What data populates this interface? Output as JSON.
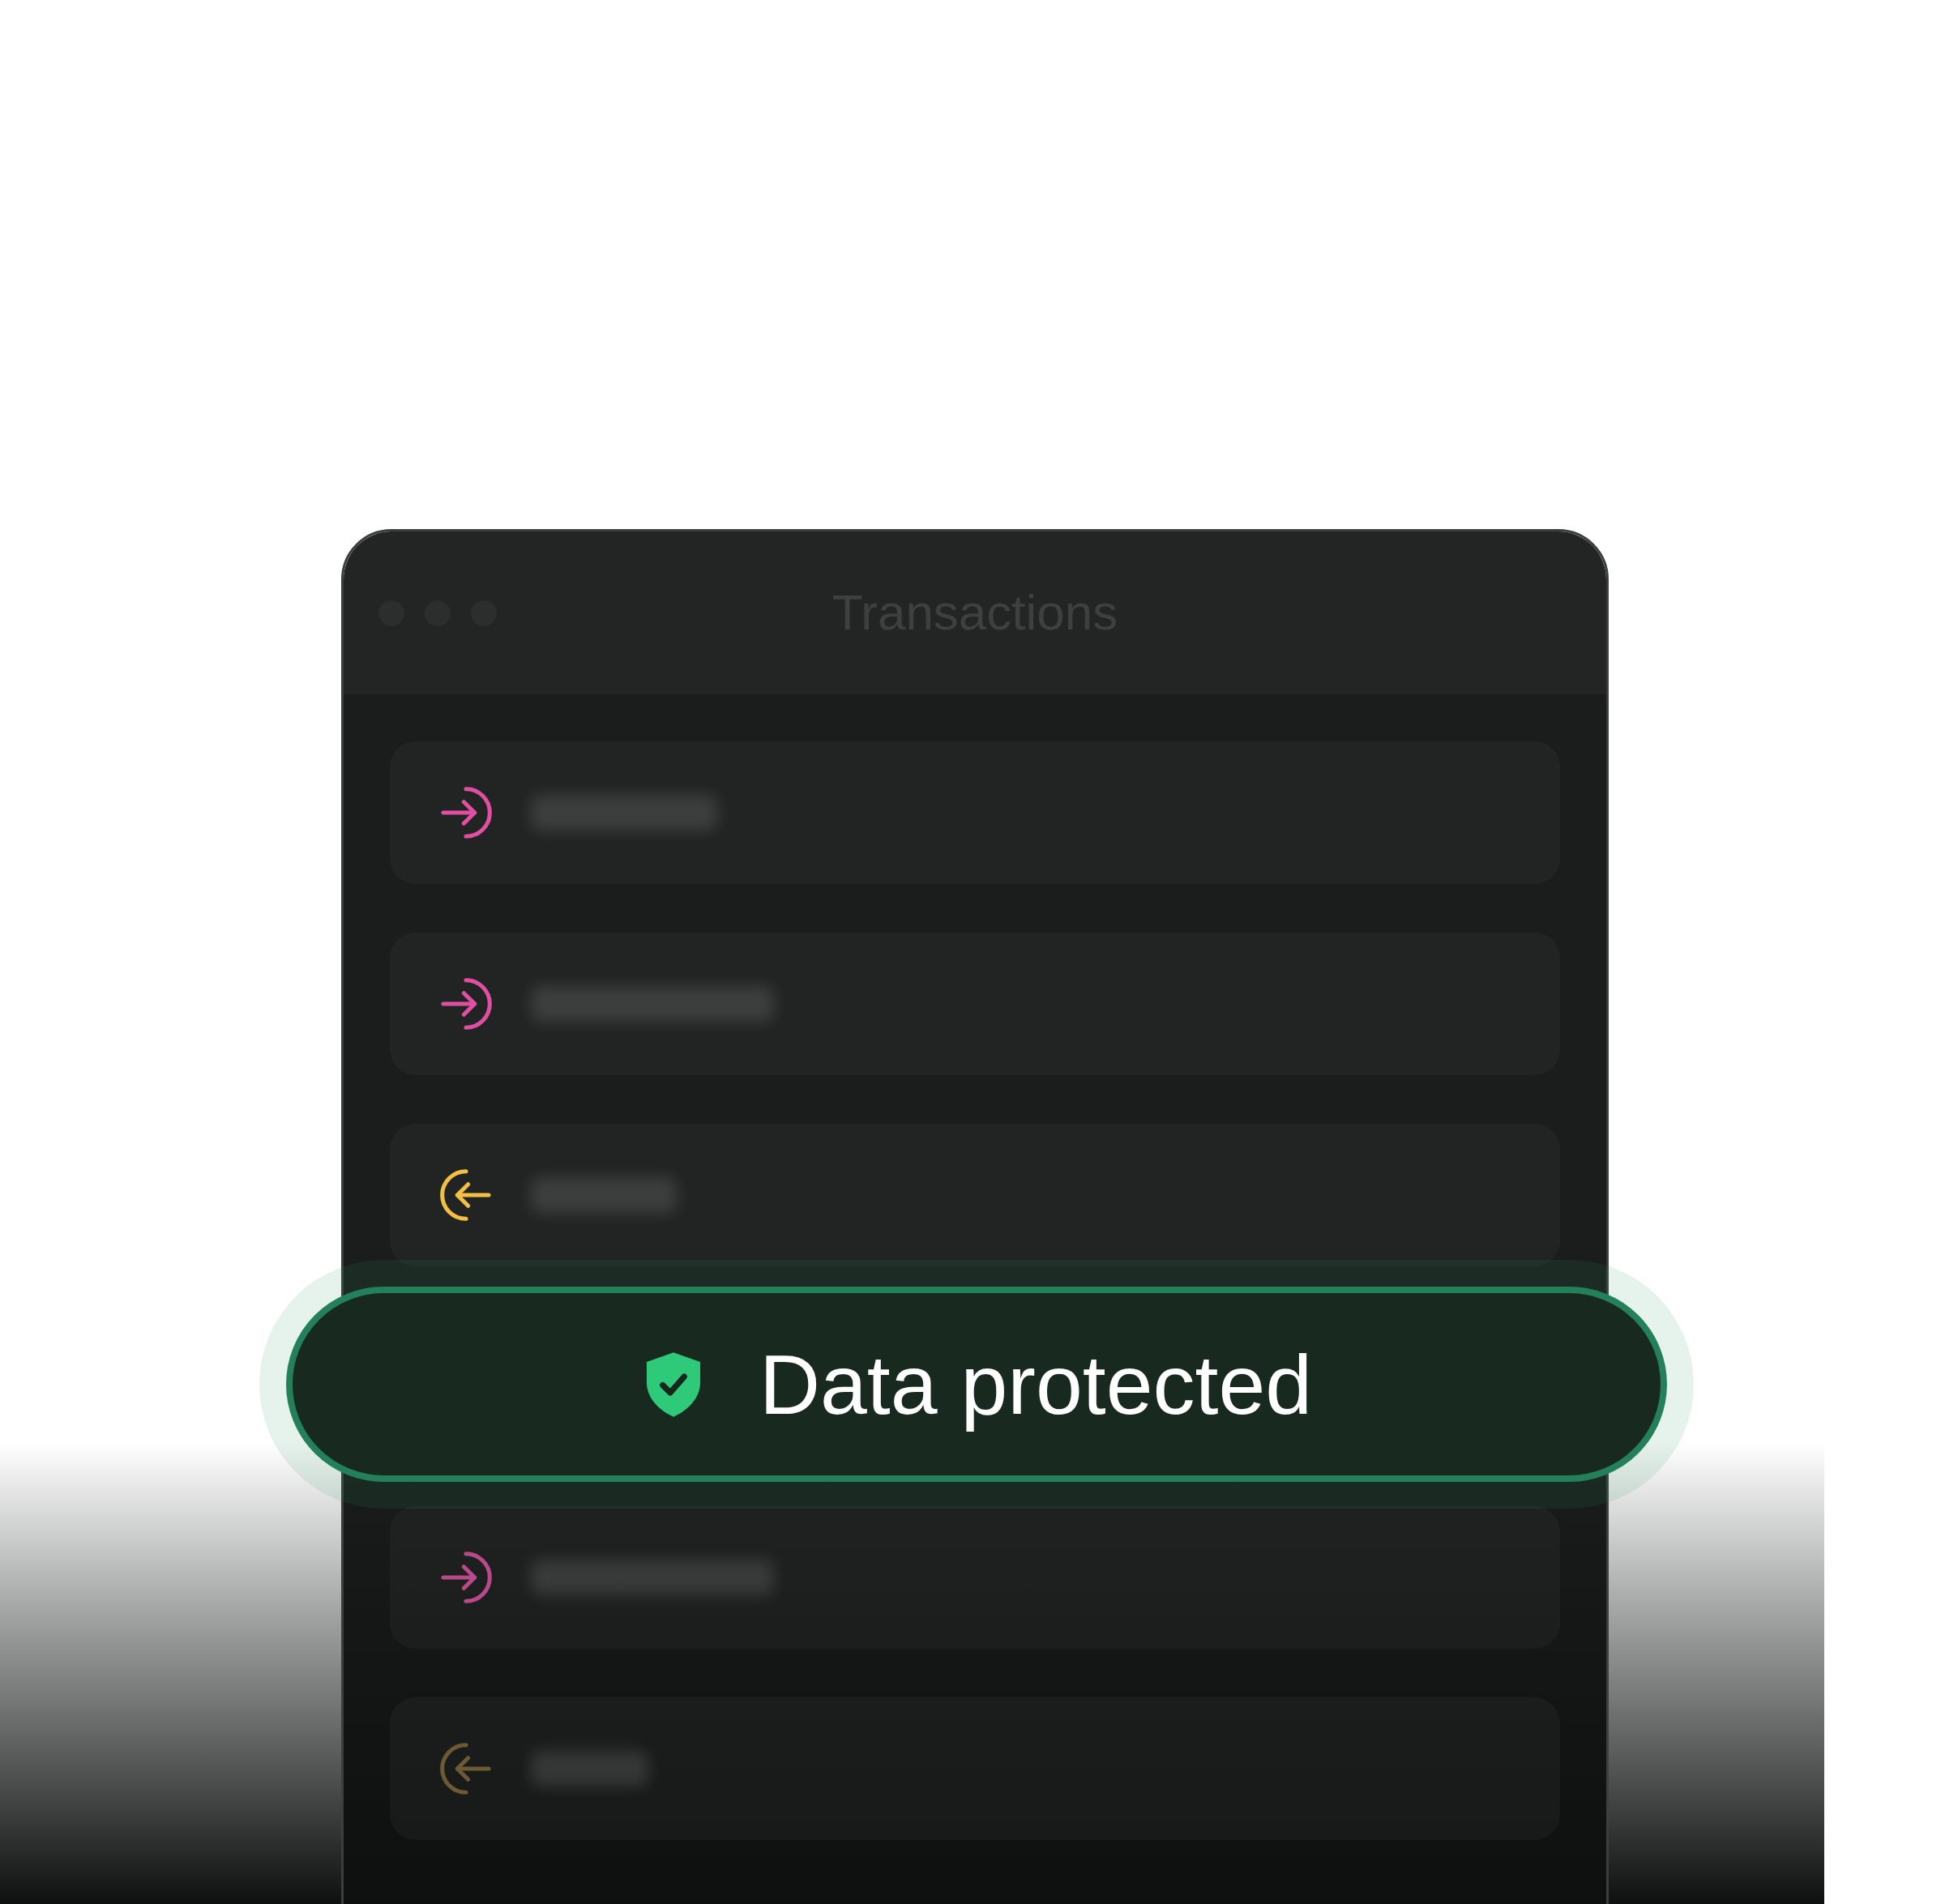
{
  "window": {
    "title": "Transactions"
  },
  "transactions": [
    {
      "kind": "incoming",
      "color": "#e14fa2"
    },
    {
      "kind": "incoming",
      "color": "#e14fa2"
    },
    {
      "kind": "outgoing",
      "color": "#f1c045"
    },
    {
      "kind": "incoming",
      "color": "#b84a8a"
    },
    {
      "kind": "outgoing",
      "color": "#6e5a32"
    }
  ],
  "badge": {
    "label": "Data protected"
  }
}
